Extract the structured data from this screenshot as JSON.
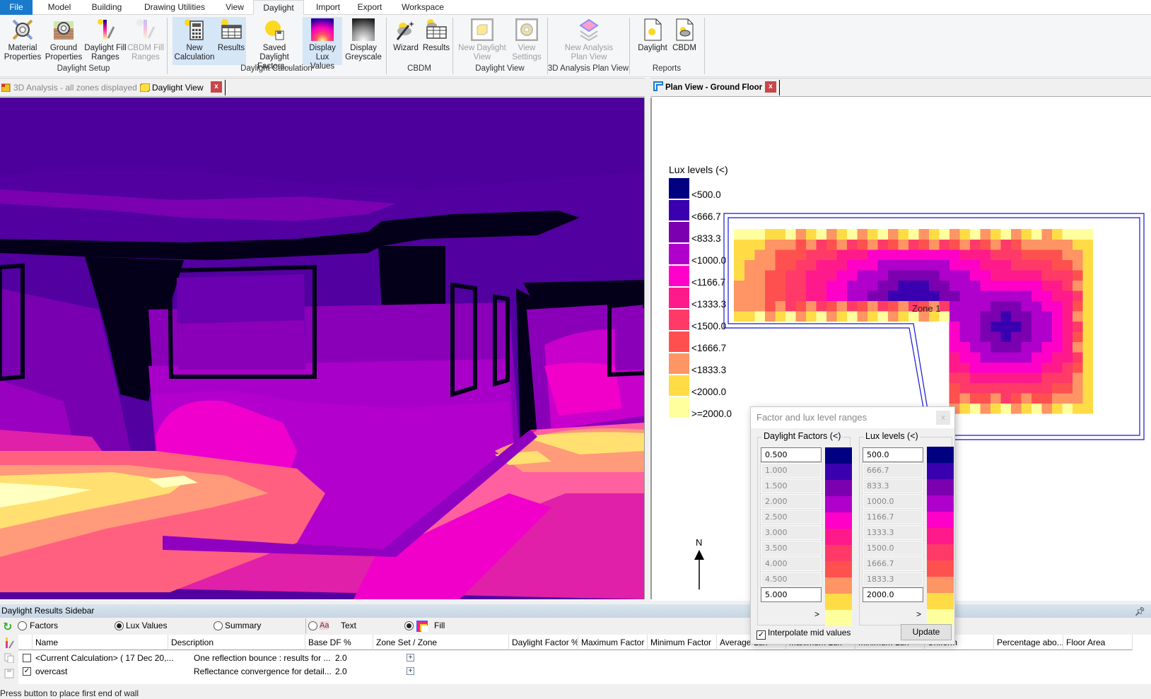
{
  "menu": {
    "items": [
      "File",
      "Model",
      "Building",
      "Drawing Utilities",
      "View",
      "Daylight",
      "Import",
      "Export",
      "Workspace"
    ],
    "active": "Daylight"
  },
  "ribbon": {
    "groups": [
      {
        "label": "Daylight Setup",
        "buttons": [
          {
            "label": "Material Properties",
            "icon": "material-gear-icon",
            "enabled": true
          },
          {
            "label": "Ground Properties",
            "icon": "ground-gear-icon",
            "enabled": true
          },
          {
            "label": "Daylight Fill Ranges",
            "icon": "fill-ranges-icon",
            "enabled": true
          },
          {
            "label": "CBDM Fill Ranges",
            "icon": "cbdm-fill-ranges-icon",
            "enabled": false
          }
        ]
      },
      {
        "label": "Daylight Calculation",
        "buttons": [
          {
            "label": "New Calculation",
            "icon": "calculator-icon",
            "enabled": true,
            "selected": true
          },
          {
            "label": "Results",
            "icon": "results-table-icon",
            "enabled": true,
            "selected": true
          },
          {
            "label": "Saved Daylight Factors...",
            "icon": "saved-factors-icon",
            "enabled": true
          },
          {
            "label": "Display Lux Values",
            "icon": "lux-gradient-icon",
            "enabled": true,
            "selected": true
          },
          {
            "label": "Display Greyscale",
            "icon": "greyscale-icon",
            "enabled": true
          }
        ]
      },
      {
        "label": "CBDM",
        "buttons": [
          {
            "label": "Wizard",
            "icon": "wizard-icon",
            "enabled": true
          },
          {
            "label": "Results",
            "icon": "cbdm-results-icon",
            "enabled": true
          }
        ]
      },
      {
        "label": "Daylight View",
        "buttons": [
          {
            "label": "New Daylight View",
            "icon": "new-view-icon",
            "enabled": false
          },
          {
            "label": "View Settings",
            "icon": "view-settings-icon",
            "enabled": false
          }
        ]
      },
      {
        "label": "3D Analysis Plan View",
        "buttons": [
          {
            "label": "New Analysis Plan View",
            "icon": "analysis-plan-icon",
            "enabled": false
          }
        ]
      },
      {
        "label": "Reports",
        "buttons": [
          {
            "label": "Daylight",
            "icon": "daylight-report-icon",
            "enabled": true
          },
          {
            "label": "CBDM",
            "icon": "cbdm-report-icon",
            "enabled": true
          }
        ]
      }
    ]
  },
  "left_tabs": {
    "tab1": "3D Analysis - all zones displayed",
    "tab2": "Daylight View",
    "close": "x"
  },
  "right_tabs": {
    "tab1": "Plan View - Ground Floor",
    "close": "x"
  },
  "legend": {
    "title": "Lux levels (<)",
    "entries": [
      {
        "label": "<500.0",
        "color": "#000080"
      },
      {
        "label": "<666.7",
        "color": "#3a00b0"
      },
      {
        "label": "<833.3",
        "color": "#7b00b0"
      },
      {
        "label": "<1000.0",
        "color": "#b000cc"
      },
      {
        "label": "<1166.7",
        "color": "#ff00c8"
      },
      {
        "label": "<1333.3",
        "color": "#ff1a8c"
      },
      {
        "label": "<1500.0",
        "color": "#ff3a68"
      },
      {
        "label": "<1666.7",
        "color": "#ff5050"
      },
      {
        "label": "<1833.3",
        "color": "#ff9464"
      },
      {
        "label": "<2000.0",
        "color": "#ffdc46"
      },
      {
        "label": ">=2000.0",
        "color": "#ffff9e"
      }
    ]
  },
  "plan": {
    "zone_label": "Zone 1",
    "north_label": "N"
  },
  "dialog": {
    "title": "Factor and lux level ranges",
    "close": "x",
    "df_title": "Daylight Factors  (<)",
    "lux_title": "Lux levels (<)",
    "df_values": [
      "0.500",
      "1.000",
      "1.500",
      "2.000",
      "2.500",
      "3.000",
      "3.500",
      "4.000",
      "4.500",
      "5.000"
    ],
    "lux_values": [
      "500.0",
      "666.7",
      "833.3",
      "1000.0",
      "1166.7",
      "1333.3",
      "1500.0",
      "1666.7",
      "1833.3",
      "2000.0"
    ],
    "gt_symbol": ">",
    "interpolate_label": "Interpolate mid values",
    "interpolate_checked": true,
    "update_label": "Update"
  },
  "sidebar": {
    "title": "Daylight Results Sidebar",
    "pin": "pin",
    "radios": {
      "factors": "Factors",
      "lux": "Lux Values",
      "summary": "Summary",
      "text": "Text",
      "fill": "Fill",
      "selected_mode": "Lux Values",
      "selected_display": "Fill"
    },
    "columns": [
      "Name",
      "Description",
      "Base DF %",
      "Zone Set / Zone",
      "Daylight Factor %",
      "Maximum Factor",
      "Minimum Factor",
      "Average Lux",
      "Maximum Lux",
      "Minimum Lux",
      "Uniform",
      "Percentage abo...",
      "Floor Area"
    ],
    "rows": [
      {
        "checked": false,
        "name": "<Current Calculation> ( 17 Dec 20,...",
        "description": "One reflection bounce : results for ...",
        "base_df": "2.0"
      },
      {
        "checked": true,
        "name": "overcast",
        "description": "Reflectance convergence for detail...",
        "base_df": "2.0"
      }
    ]
  },
  "status": "Press button to place first end of wall"
}
